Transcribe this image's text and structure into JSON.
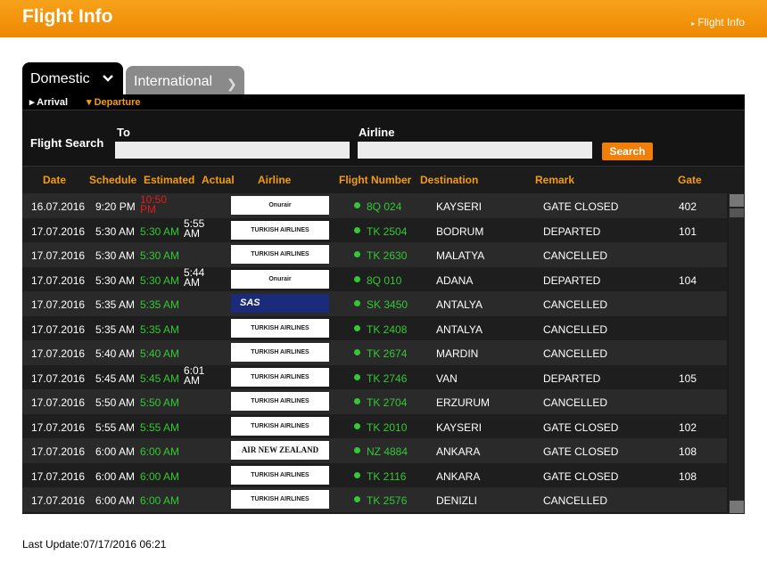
{
  "header": {
    "title": "Flight Info",
    "breadcrumb": "Flight Info"
  },
  "tabs": {
    "domestic": "Domestic",
    "international": "International"
  },
  "subtabs": {
    "arrival": "Arrival",
    "departure": "Departure"
  },
  "search": {
    "label": "Flight Search",
    "to_label": "To",
    "to_value": "",
    "airline_label": "Airline",
    "airline_value": "",
    "button": "Search"
  },
  "columns": {
    "date": "Date",
    "schedule": "Schedule",
    "estimated": "Estimated",
    "actual": "Actual",
    "airline": "Airline",
    "flight_number": "Flight Number",
    "destination": "Destination",
    "remark": "Remark",
    "gate": "Gate"
  },
  "flights": [
    {
      "date": "16.07.2016",
      "schedule": "9:20 PM",
      "estimated": "10:50 PM",
      "estimated_color": "red",
      "actual": "",
      "airline": "onurair",
      "airline_text": "Onurair",
      "flight": "8Q 024",
      "destination": "KAYSERI",
      "remark": "GATE CLOSED",
      "gate": "402"
    },
    {
      "date": "17.07.2016",
      "schedule": "5:30 AM",
      "estimated": "5:30 AM",
      "actual": "5:55 AM",
      "airline": "turkish",
      "airline_text": "TURKISH AIRLINES",
      "flight": "TK 2504",
      "destination": "BODRUM",
      "remark": "DEPARTED",
      "gate": "101"
    },
    {
      "date": "17.07.2016",
      "schedule": "5:30 AM",
      "estimated": "5:30 AM",
      "actual": "",
      "airline": "turkish",
      "airline_text": "TURKISH AIRLINES",
      "flight": "TK 2630",
      "destination": "MALATYA",
      "remark": "CANCELLED",
      "gate": ""
    },
    {
      "date": "17.07.2016",
      "schedule": "5:30 AM",
      "estimated": "5:30 AM",
      "actual": "5:44 AM",
      "airline": "onurair",
      "airline_text": "Onurair",
      "flight": "8Q 010",
      "destination": "ADANA",
      "remark": "DEPARTED",
      "gate": "104"
    },
    {
      "date": "17.07.2016",
      "schedule": "5:35 AM",
      "estimated": "5:35 AM",
      "actual": "",
      "airline": "sas",
      "airline_text": "SAS",
      "flight": "SK 3450",
      "destination": "ANTALYA",
      "remark": "CANCELLED",
      "gate": ""
    },
    {
      "date": "17.07.2016",
      "schedule": "5:35 AM",
      "estimated": "5:35 AM",
      "actual": "",
      "airline": "turkish",
      "airline_text": "TURKISH AIRLINES",
      "flight": "TK 2408",
      "destination": "ANTALYA",
      "remark": "CANCELLED",
      "gate": ""
    },
    {
      "date": "17.07.2016",
      "schedule": "5:40 AM",
      "estimated": "5:40 AM",
      "actual": "",
      "airline": "turkish",
      "airline_text": "TURKISH AIRLINES",
      "flight": "TK 2674",
      "destination": "MARDIN",
      "remark": "CANCELLED",
      "gate": ""
    },
    {
      "date": "17.07.2016",
      "schedule": "5:45 AM",
      "estimated": "5:45 AM",
      "actual": "6:01 AM",
      "airline": "turkish",
      "airline_text": "TURKISH AIRLINES",
      "flight": "TK 2746",
      "destination": "VAN",
      "remark": "DEPARTED",
      "gate": "105"
    },
    {
      "date": "17.07.2016",
      "schedule": "5:50 AM",
      "estimated": "5:50 AM",
      "actual": "",
      "airline": "turkish",
      "airline_text": "TURKISH AIRLINES",
      "flight": "TK 2704",
      "destination": "ERZURUM",
      "remark": "CANCELLED",
      "gate": ""
    },
    {
      "date": "17.07.2016",
      "schedule": "5:55 AM",
      "estimated": "5:55 AM",
      "actual": "",
      "airline": "turkish",
      "airline_text": "TURKISH AIRLINES",
      "flight": "TK 2010",
      "destination": "KAYSERI",
      "remark": "GATE CLOSED",
      "gate": "102"
    },
    {
      "date": "17.07.2016",
      "schedule": "6:00 AM",
      "estimated": "6:00 AM",
      "actual": "",
      "airline": "anz",
      "airline_text": "AIR NEW ZEALAND",
      "flight": "NZ 4884",
      "destination": "ANKARA",
      "remark": "GATE CLOSED",
      "gate": "108"
    },
    {
      "date": "17.07.2016",
      "schedule": "6:00 AM",
      "estimated": "6:00 AM",
      "actual": "",
      "airline": "turkish",
      "airline_text": "TURKISH AIRLINES",
      "flight": "TK 2116",
      "destination": "ANKARA",
      "remark": "GATE CLOSED",
      "gate": "108"
    },
    {
      "date": "17.07.2016",
      "schedule": "6:00 AM",
      "estimated": "6:00 AM",
      "actual": "",
      "airline": "turkish",
      "airline_text": "TURKISH AIRLINES",
      "flight": "TK 2576",
      "destination": "DENIZLI",
      "remark": "CANCELLED",
      "gate": ""
    }
  ],
  "footer": {
    "last_update": "Last Update:07/17/2016 06:21"
  },
  "colors": {
    "accent": "#f39c12",
    "on_time": "#34c834",
    "delayed": "#e21b1b"
  }
}
